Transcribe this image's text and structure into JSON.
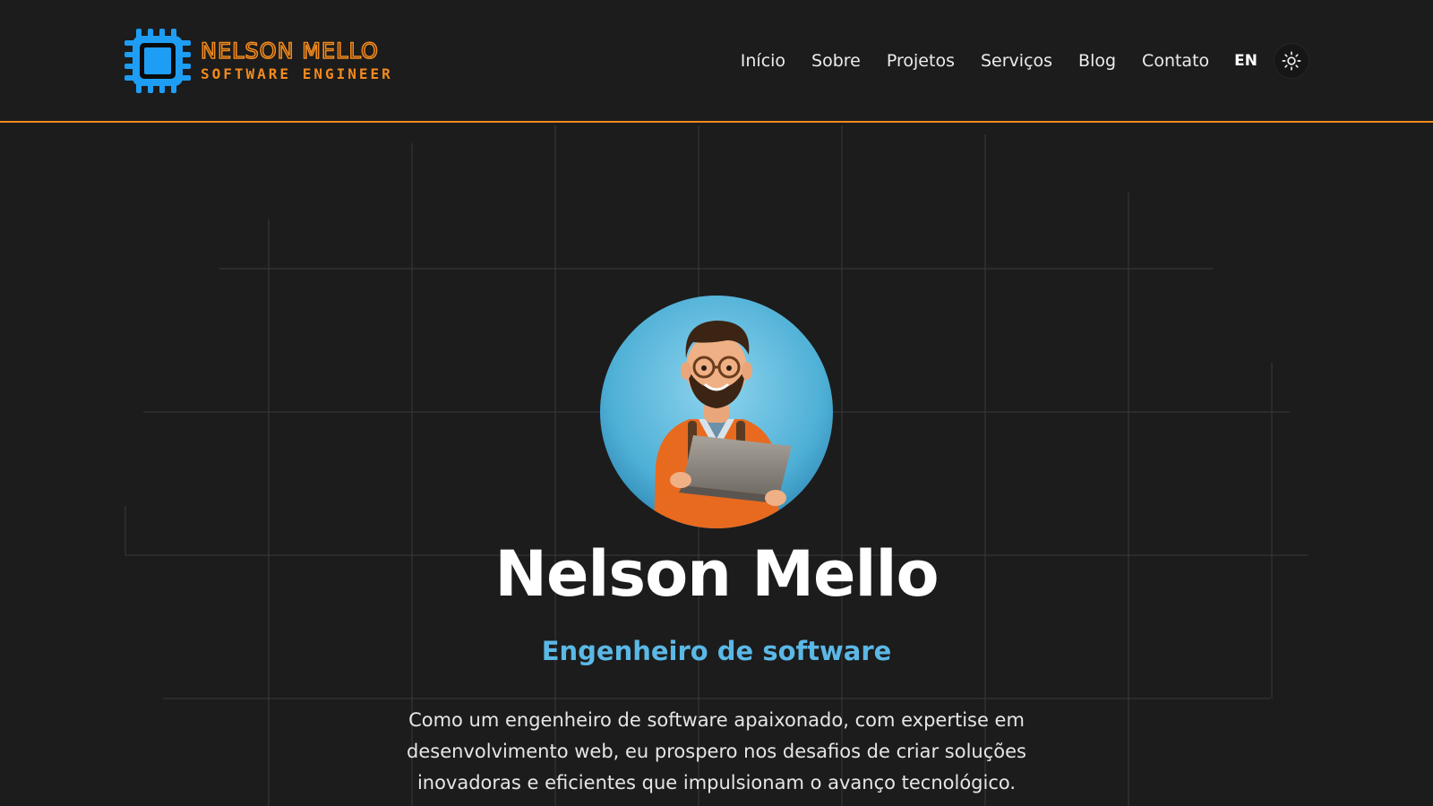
{
  "logo": {
    "name": "NELSON MELLO",
    "tagline": "SOFTWARE ENGINEER"
  },
  "nav": {
    "items": [
      {
        "label": "Início"
      },
      {
        "label": "Sobre"
      },
      {
        "label": "Projetos"
      },
      {
        "label": "Serviços"
      },
      {
        "label": "Blog"
      },
      {
        "label": "Contato"
      }
    ],
    "language": "EN",
    "theme_icon": "sun-icon"
  },
  "hero": {
    "avatar_icon": "developer-avatar-icon",
    "name": "Nelson Mello",
    "role": "Engenheiro de software",
    "description": "Como um engenheiro de software apaixonado, com expertise em desenvolvimento web, eu prospero nos desafios de criar soluções inovadoras e eficientes que impulsionam o avanço tecnológico."
  },
  "colors": {
    "background": "#1c1c1c",
    "accent_orange": "#f28a1e",
    "accent_blue": "#1e9df5",
    "role_blue": "#5bb8e6",
    "text": "#ececec"
  }
}
